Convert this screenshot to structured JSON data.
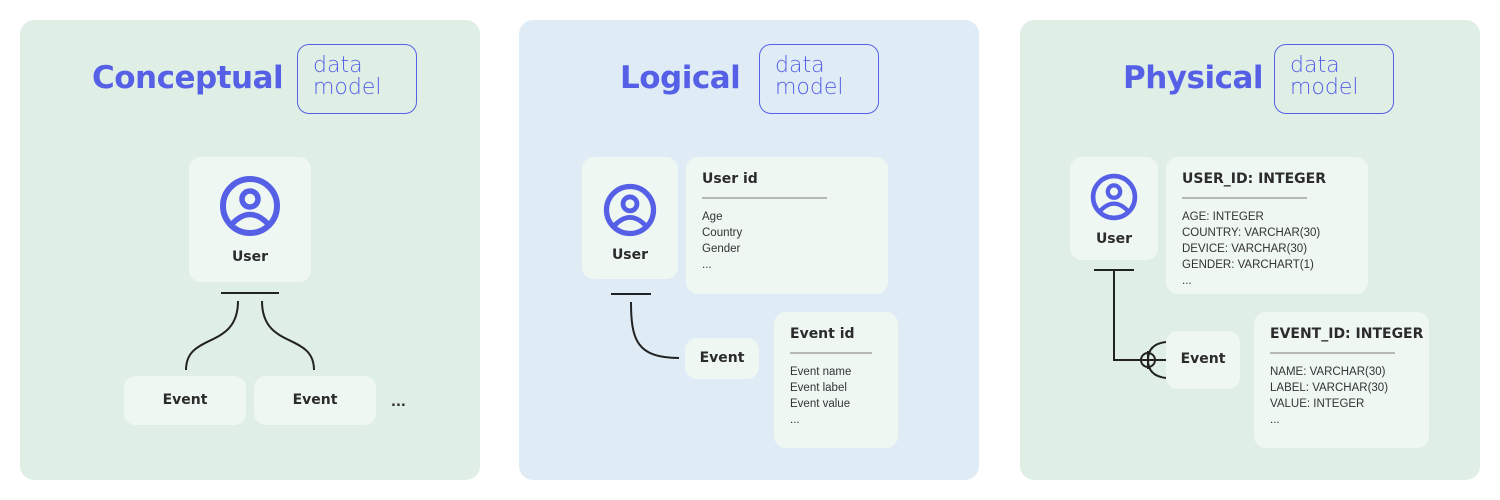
{
  "colors": {
    "accent": "#5560e6",
    "panel_green": "#e0efe6",
    "panel_blue": "#dfecf5",
    "card": "#eff7f2",
    "line": "#222222"
  },
  "panels": [
    {
      "title": "Conceptual",
      "badge": [
        "data",
        "model"
      ],
      "user_label": "User",
      "events": [
        "Event",
        "Event"
      ],
      "more": "..."
    },
    {
      "title": "Logical",
      "badge": [
        "data",
        "model"
      ],
      "user_label": "User",
      "user_entity": {
        "header": "User id",
        "attributes": [
          "Age",
          "Country",
          "Gender",
          "..."
        ]
      },
      "event_label": "Event",
      "event_entity": {
        "header": "Event id",
        "attributes": [
          "Event name",
          "Event label",
          "Event value",
          "..."
        ]
      }
    },
    {
      "title": "Physical",
      "badge": [
        "data",
        "model"
      ],
      "user_label": "User",
      "user_entity": {
        "header": "USER_ID: INTEGER",
        "attributes": [
          "AGE: INTEGER",
          "COUNTRY: VARCHAR(30)",
          "DEVICE: VARCHAR(30)",
          "GENDER: VARCHART(1)",
          "..."
        ]
      },
      "event_label": "Event",
      "event_entity": {
        "header": "EVENT_ID: INTEGER",
        "attributes": [
          "NAME: VARCHAR(30)",
          "LABEL: VARCHAR(30)",
          "VALUE: INTEGER",
          "..."
        ]
      }
    }
  ],
  "icons": {
    "user": "user-circle-icon"
  }
}
